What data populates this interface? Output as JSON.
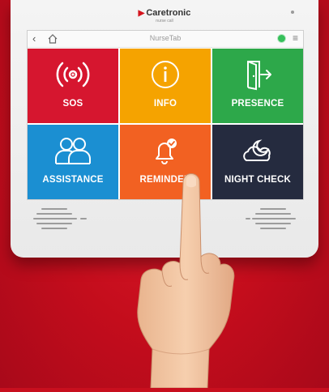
{
  "device": {
    "brand": "Caretronic",
    "brand_sub": "nurse call"
  },
  "topbar": {
    "back_icon": "chevron-left-icon",
    "home_icon": "home-icon",
    "title": "NurseTab",
    "status_color": "#35c05a",
    "menu_icon": "hamburger-icon"
  },
  "tiles": [
    {
      "label": "SOS",
      "icon": "alarm-signal-icon",
      "color": "#d6162f"
    },
    {
      "label": "INFO",
      "icon": "info-icon",
      "color": "#f5a300"
    },
    {
      "label": "PRESENCE",
      "icon": "door-exit-icon",
      "color": "#2da84a"
    },
    {
      "label": "ASSISTANCE",
      "icon": "two-people-icon",
      "color": "#1b8fd2"
    },
    {
      "label": "REMINDER",
      "icon": "bell-check-icon",
      "color": "#f26122"
    },
    {
      "label": "NIGHT CHECK",
      "icon": "moon-cloud-icon",
      "color": "#252b3f"
    }
  ]
}
